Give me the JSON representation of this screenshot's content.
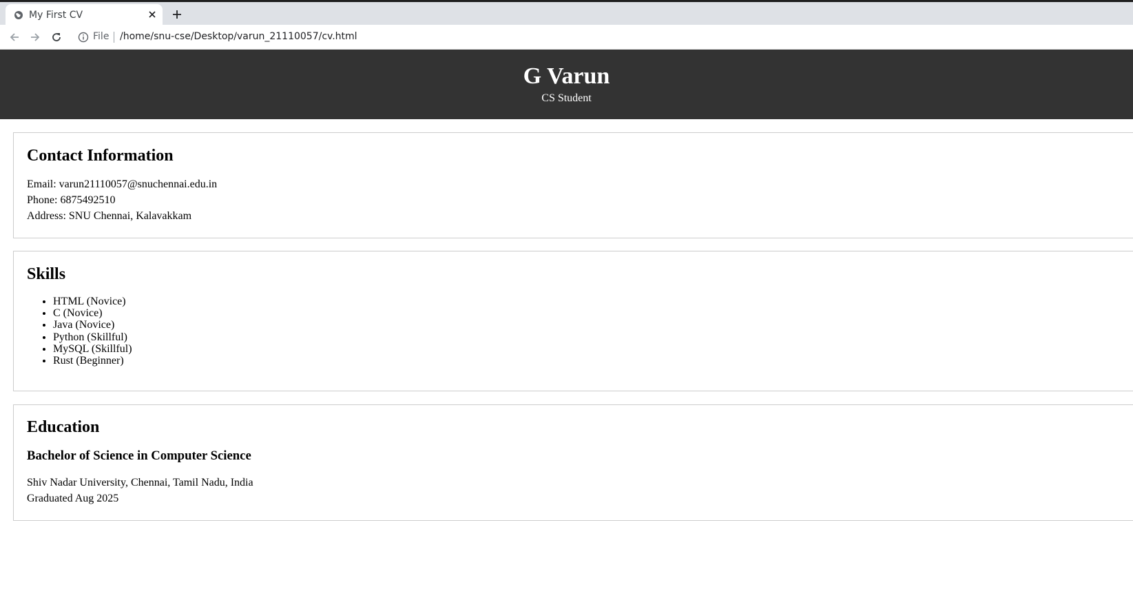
{
  "browser": {
    "tab_title": "My First CV",
    "omnibox_scheme_label": "File",
    "url": "/home/snu-cse/Desktop/varun_21110057/cv.html",
    "icons": [
      "globe-icon",
      "close-icon",
      "plus-icon",
      "back-arrow-icon",
      "forward-arrow-icon",
      "reload-icon",
      "info-icon",
      "share-icon"
    ]
  },
  "header": {
    "name": "G Varun",
    "subtitle": "CS Student",
    "background_color": "#333333"
  },
  "contact": {
    "heading": "Contact Information",
    "email": "Email: varun21110057@snuchennai.edu.in",
    "phone": "Phone: 6875492510",
    "address": "Address: SNU Chennai, Kalavakkam"
  },
  "skills": {
    "heading": "Skills",
    "items": [
      "HTML (Novice)",
      "C (Novice)",
      "Java (Novice)",
      "Python (Skillful)",
      "MySQL (Skillful)",
      "Rust (Beginner)"
    ]
  },
  "education": {
    "heading": "Education",
    "degree": "Bachelor of Science in Computer Science",
    "institution": "Shiv Nadar University, Chennai, Tamil Nadu, India",
    "graduation": "Graduated Aug 2025"
  }
}
